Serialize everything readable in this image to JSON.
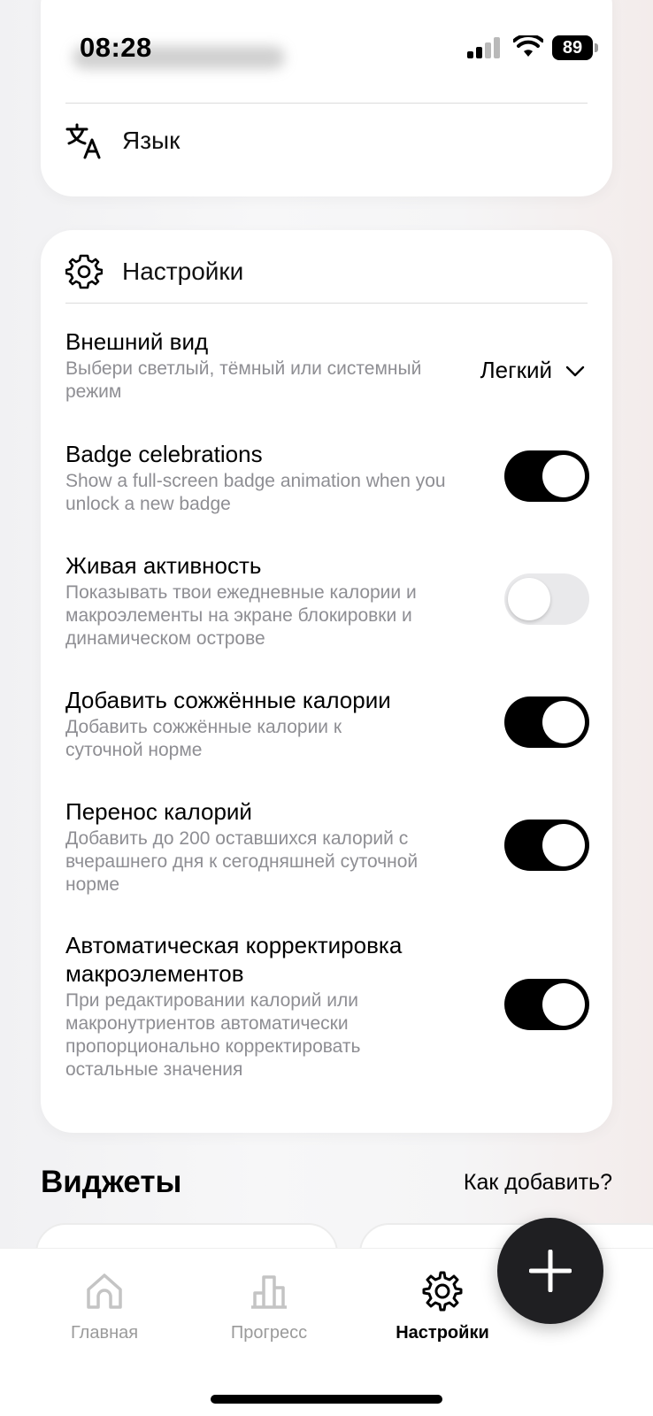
{
  "status_bar": {
    "time": "08:28",
    "battery": "89"
  },
  "top_card": {
    "language_label": "Язык",
    "language_icon": "translate-icon"
  },
  "settings": {
    "header_label": "Настройки",
    "header_icon": "gear-icon",
    "appearance": {
      "title": "Внешний вид",
      "description": "Выбери светлый, тёмный или системный режим",
      "value": "Легкий"
    },
    "toggles": [
      {
        "title": "Badge celebrations",
        "description": "Show a full-screen badge animation when you unlock a new badge",
        "on": true
      },
      {
        "title": "Живая активность",
        "description": "Показывать твои ежедневные калории и макроэлементы на экране блокировки и динамическом острове",
        "on": false
      },
      {
        "title": "Добавить сожжённые калории",
        "description": "Добавить сожжённые калории к суточной норме",
        "on": true
      },
      {
        "title": "Перенос калорий",
        "description": "Добавить до 200 оставшихся калорий с вчерашнего дня к сегодняшней суточной норме",
        "on": true
      },
      {
        "title": "Автоматическая корректировка макроэлементов",
        "description": "При редактировании калорий или макронутриентов автоматически пропорционально корректировать остальные значения",
        "on": true
      }
    ]
  },
  "widgets": {
    "title": "Виджеты",
    "how_to_add": "Как добавить?"
  },
  "tabbar": {
    "home": "Главная",
    "progress": "Прогресс",
    "settings": "Настройки"
  },
  "colors": {
    "toggle_on": "#000000",
    "toggle_off": "#e9e9eb",
    "muted_text": "#8e8e93",
    "fab": "#1f1f22"
  }
}
